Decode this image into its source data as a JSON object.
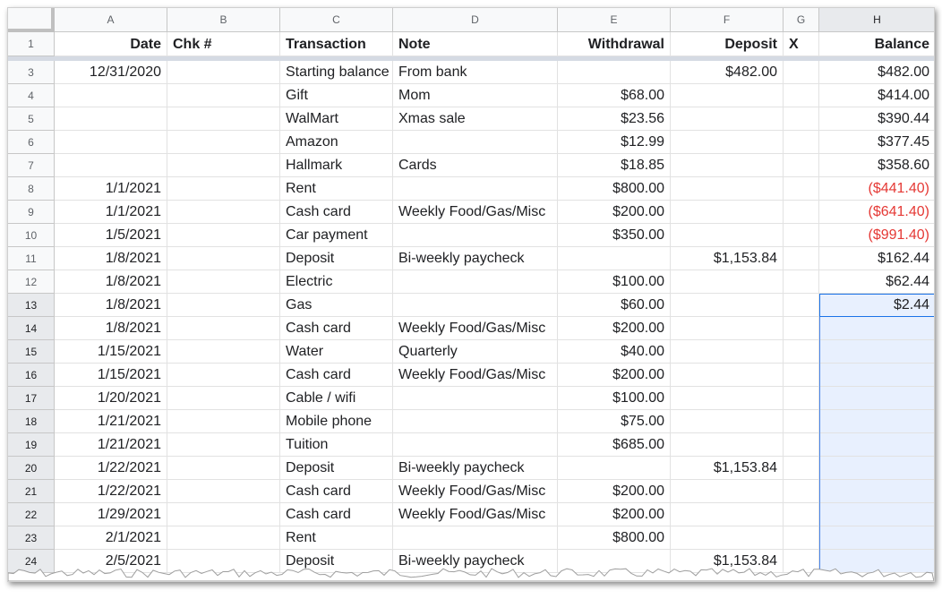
{
  "columns": [
    "A",
    "B",
    "C",
    "D",
    "E",
    "F",
    "G",
    "H"
  ],
  "header_row": {
    "row_number": "1",
    "cells": [
      "Date",
      "Chk #",
      "Transaction",
      "Note",
      "Withdrawal",
      "Deposit",
      "X",
      "Balance"
    ]
  },
  "rows": [
    {
      "n": "3",
      "date": "12/31/2020",
      "chk": "",
      "transaction": "Starting balance",
      "note": "From bank",
      "withdrawal": "",
      "deposit": "$482.00",
      "x": "",
      "balance": "$482.00",
      "negative": false
    },
    {
      "n": "4",
      "date": "",
      "chk": "",
      "transaction": "Gift",
      "note": "Mom",
      "withdrawal": "$68.00",
      "deposit": "",
      "x": "",
      "balance": "$414.00",
      "negative": false
    },
    {
      "n": "5",
      "date": "",
      "chk": "",
      "transaction": "WalMart",
      "note": "Xmas sale",
      "withdrawal": "$23.56",
      "deposit": "",
      "x": "",
      "balance": "$390.44",
      "negative": false
    },
    {
      "n": "6",
      "date": "",
      "chk": "",
      "transaction": "Amazon",
      "note": "",
      "withdrawal": "$12.99",
      "deposit": "",
      "x": "",
      "balance": "$377.45",
      "negative": false
    },
    {
      "n": "7",
      "date": "",
      "chk": "",
      "transaction": "Hallmark",
      "note": "Cards",
      "withdrawal": "$18.85",
      "deposit": "",
      "x": "",
      "balance": "$358.60",
      "negative": false
    },
    {
      "n": "8",
      "date": "1/1/2021",
      "chk": "",
      "transaction": "Rent",
      "note": "",
      "withdrawal": "$800.00",
      "deposit": "",
      "x": "",
      "balance": "($441.40)",
      "negative": true
    },
    {
      "n": "9",
      "date": "1/1/2021",
      "chk": "",
      "transaction": "Cash card",
      "note": "Weekly Food/Gas/Misc",
      "withdrawal": "$200.00",
      "deposit": "",
      "x": "",
      "balance": "($641.40)",
      "negative": true
    },
    {
      "n": "10",
      "date": "1/5/2021",
      "chk": "",
      "transaction": "Car payment",
      "note": "",
      "withdrawal": "$350.00",
      "deposit": "",
      "x": "",
      "balance": "($991.40)",
      "negative": true
    },
    {
      "n": "11",
      "date": "1/8/2021",
      "chk": "",
      "transaction": "Deposit",
      "note": "Bi-weekly paycheck",
      "withdrawal": "",
      "deposit": "$1,153.84",
      "x": "",
      "balance": "$162.44",
      "negative": false
    },
    {
      "n": "12",
      "date": "1/8/2021",
      "chk": "",
      "transaction": "Electric",
      "note": "",
      "withdrawal": "$100.00",
      "deposit": "",
      "x": "",
      "balance": "$62.44",
      "negative": false
    },
    {
      "n": "13",
      "date": "1/8/2021",
      "chk": "",
      "transaction": "Gas",
      "note": "",
      "withdrawal": "$60.00",
      "deposit": "",
      "x": "",
      "balance": "$2.44",
      "negative": false
    },
    {
      "n": "14",
      "date": "1/8/2021",
      "chk": "",
      "transaction": "Cash card",
      "note": "Weekly Food/Gas/Misc",
      "withdrawal": "$200.00",
      "deposit": "",
      "x": "",
      "balance": "",
      "negative": false
    },
    {
      "n": "15",
      "date": "1/15/2021",
      "chk": "",
      "transaction": "Water",
      "note": "Quarterly",
      "withdrawal": "$40.00",
      "deposit": "",
      "x": "",
      "balance": "",
      "negative": false
    },
    {
      "n": "16",
      "date": "1/15/2021",
      "chk": "",
      "transaction": "Cash card",
      "note": "Weekly Food/Gas/Misc",
      "withdrawal": "$200.00",
      "deposit": "",
      "x": "",
      "balance": "",
      "negative": false
    },
    {
      "n": "17",
      "date": "1/20/2021",
      "chk": "",
      "transaction": "Cable / wifi",
      "note": "",
      "withdrawal": "$100.00",
      "deposit": "",
      "x": "",
      "balance": "",
      "negative": false
    },
    {
      "n": "18",
      "date": "1/21/2021",
      "chk": "",
      "transaction": "Mobile phone",
      "note": "",
      "withdrawal": "$75.00",
      "deposit": "",
      "x": "",
      "balance": "",
      "negative": false
    },
    {
      "n": "19",
      "date": "1/21/2021",
      "chk": "",
      "transaction": "Tuition",
      "note": "",
      "withdrawal": "$685.00",
      "deposit": "",
      "x": "",
      "balance": "",
      "negative": false
    },
    {
      "n": "20",
      "date": "1/22/2021",
      "chk": "",
      "transaction": "Deposit",
      "note": "Bi-weekly paycheck",
      "withdrawal": "",
      "deposit": "$1,153.84",
      "x": "",
      "balance": "",
      "negative": false
    },
    {
      "n": "21",
      "date": "1/22/2021",
      "chk": "",
      "transaction": "Cash card",
      "note": "Weekly Food/Gas/Misc",
      "withdrawal": "$200.00",
      "deposit": "",
      "x": "",
      "balance": "",
      "negative": false
    },
    {
      "n": "22",
      "date": "1/29/2021",
      "chk": "",
      "transaction": "Cash card",
      "note": "Weekly Food/Gas/Misc",
      "withdrawal": "$200.00",
      "deposit": "",
      "x": "",
      "balance": "",
      "negative": false
    },
    {
      "n": "23",
      "date": "2/1/2021",
      "chk": "",
      "transaction": "Rent",
      "note": "",
      "withdrawal": "$800.00",
      "deposit": "",
      "x": "",
      "balance": "",
      "negative": false
    },
    {
      "n": "24",
      "date": "2/5/2021",
      "chk": "",
      "transaction": "Deposit",
      "note": "Bi-weekly paycheck",
      "withdrawal": "",
      "deposit": "$1,153.84",
      "x": "",
      "balance": "",
      "negative": false
    }
  ],
  "selection": {
    "column": "H",
    "active_row": "13",
    "range_end_row": "24"
  },
  "colors": {
    "negative": "#e53935",
    "selection": "#1a73e8",
    "selection_fill": "#e8f0fe"
  }
}
